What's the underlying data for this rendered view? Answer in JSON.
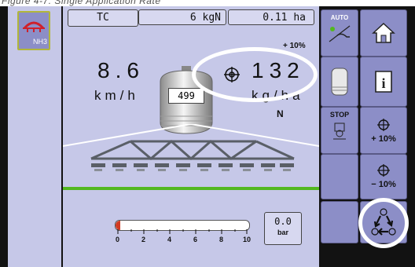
{
  "caption": "Figure 4-7: Single Application Rate",
  "left": {
    "nh3_label": "NH3"
  },
  "topbar": {
    "mode": "TC",
    "rate_display": "6 kgN",
    "area": "0.11 ha"
  },
  "speed": {
    "value": "8.6",
    "unit": "km/h"
  },
  "tank": {
    "level": "499"
  },
  "application": {
    "increment": "+ 10%",
    "rate_value": "132",
    "rate_unit": "kg/ha",
    "product": "N"
  },
  "pressure": {
    "value": "0.0",
    "unit": "bar",
    "gauge_ticks": [
      "0",
      "2",
      "4",
      "6",
      "8",
      "10"
    ],
    "gauge_level": 0
  },
  "sidebar": {
    "auto_label": "AUTO",
    "stop_label": "STOP",
    "rate_up_label": "+ 10%",
    "rate_down_label": "− 10%"
  },
  "colors": {
    "screen_bg": "#c6c8e8",
    "button": "#8c8ec7",
    "accent_green": "#53b81f",
    "boom": "#5a5f67",
    "pressure_red": "#d23a22"
  }
}
